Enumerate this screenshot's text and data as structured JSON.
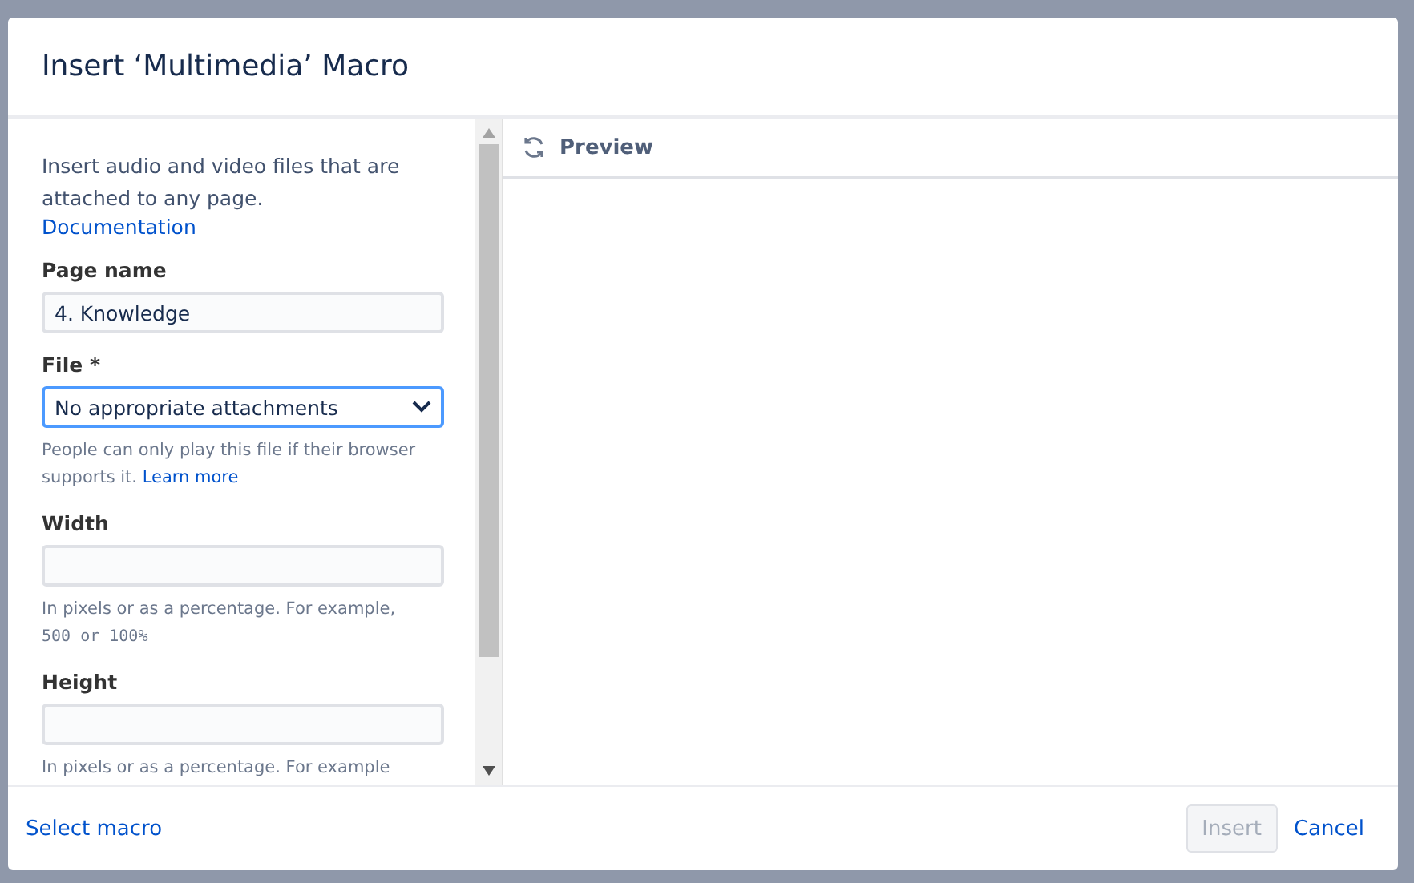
{
  "dialog": {
    "title": "Insert ‘Multimedia’ Macro"
  },
  "left_panel": {
    "description": "Insert audio and video files that are attached to any page.",
    "doc_link": "Documentation",
    "fields": [
      {
        "kind": "text",
        "label": "Page name",
        "value": "4. Knowledge"
      },
      {
        "kind": "select",
        "label": "File *",
        "value": "No appropriate attachments",
        "focused": true,
        "help": "People can only play this file if their browser supports it.",
        "help_link": "Learn more"
      },
      {
        "kind": "text",
        "label": "Width",
        "help": "In pixels or as a percentage. For example,",
        "help_code": "500 or 100%"
      },
      {
        "kind": "text",
        "label": "Height",
        "help": "In pixels or as a percentage. For example"
      }
    ]
  },
  "preview": {
    "label": "Preview"
  },
  "footer": {
    "left_link": "Select macro",
    "buttons": [
      {
        "label": "Insert",
        "kind": "button",
        "disabled": true
      },
      {
        "label": "Cancel",
        "kind": "link",
        "disabled": false
      }
    ]
  }
}
